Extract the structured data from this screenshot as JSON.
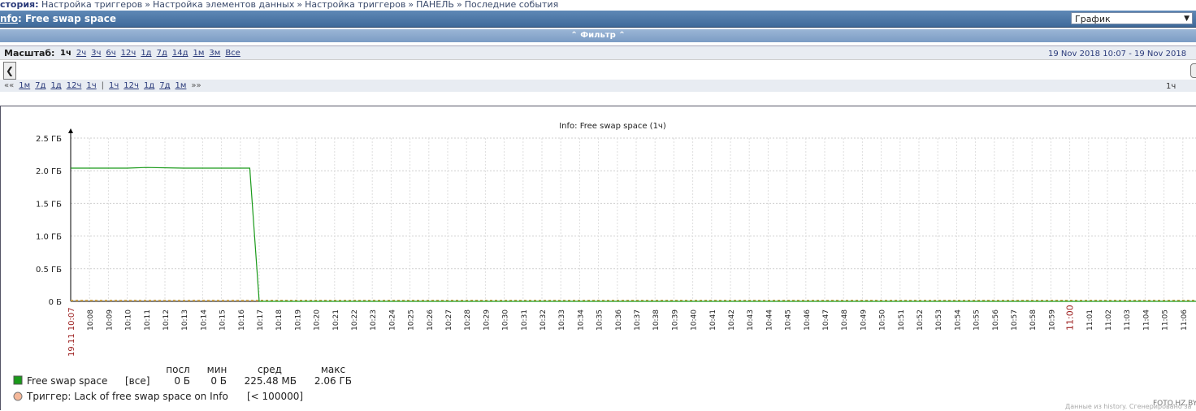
{
  "breadcrumb": {
    "items": [
      "стория:",
      "Настройка триггеров",
      "Настройка элементов данных",
      "Настройка триггеров",
      "ПАНЕЛЬ",
      "Последние события"
    ],
    "separator": "»"
  },
  "header": {
    "host": "nfo",
    "title_rest": ": Free swap space",
    "view_select": "График"
  },
  "filter": {
    "label": "Фильтр"
  },
  "scale": {
    "label": "Масштаб:",
    "options": [
      "1ч",
      "2ч",
      "3ч",
      "6ч",
      "12ч",
      "1д",
      "7д",
      "14д",
      "1м",
      "3м",
      "Все"
    ],
    "active": "1ч",
    "date_from": "19 Nov 2018 10:07",
    "date_sep": "-",
    "date_to": "19 Nov 2018"
  },
  "nav": {
    "back_glyph": "««",
    "back": [
      "1м",
      "7д",
      "1д",
      "12ч",
      "1ч"
    ],
    "divider": "|",
    "forward": [
      "1ч",
      "12ч",
      "1д",
      "7д",
      "1м"
    ],
    "fwd_glyph": "»»",
    "period": "1ч"
  },
  "chart_data": {
    "type": "line",
    "title": "Info: Free swap space (1ч)",
    "y_ticks": [
      "2.5 ГБ",
      "2.0 ГБ",
      "1.5 ГБ",
      "1.0 ГБ",
      "0.5 ГБ",
      "0 Б"
    ],
    "ylim_gb": [
      0,
      2.5
    ],
    "x_ticks": [
      "10:08",
      "10:09",
      "10:10",
      "10:11",
      "10:12",
      "10:13",
      "10:14",
      "10:15",
      "10:16",
      "10:17",
      "10:18",
      "10:19",
      "10:20",
      "10:21",
      "10:22",
      "10:23",
      "10:24",
      "10:25",
      "10:26",
      "10:27",
      "10:28",
      "10:29",
      "10:30",
      "10:31",
      "10:32",
      "10:33",
      "10:34",
      "10:35",
      "10:36",
      "10:37",
      "10:38",
      "10:39",
      "10:40",
      "10:41",
      "10:42",
      "10:43",
      "10:44",
      "10:45",
      "10:46",
      "10:47",
      "10:48",
      "10:49",
      "10:50",
      "10:51",
      "10:52",
      "10:53",
      "10:54",
      "10:55",
      "10:56",
      "10:57",
      "10:58",
      "10:59",
      "11:00",
      "11:01",
      "11:02",
      "11:03",
      "11:04",
      "11:05",
      "11:06"
    ],
    "x_start_label": "19.11 10:07",
    "highlight_tick": "11:00",
    "series": [
      {
        "name": "Free swap space",
        "color": "#1a9a1a",
        "points": [
          {
            "t": "10:07",
            "gb": 2.04
          },
          {
            "t": "10:10",
            "gb": 2.04
          },
          {
            "t": "10:11",
            "gb": 2.05
          },
          {
            "t": "10:13",
            "gb": 2.04
          },
          {
            "t": "10:16",
            "gb": 2.04
          },
          {
            "t": "10:16.5",
            "gb": 2.04
          },
          {
            "t": "10:17",
            "gb": 0
          },
          {
            "t": "11:07",
            "gb": 0
          }
        ]
      }
    ],
    "trigger": {
      "name": "Триггер: Lack of free swap space on Info",
      "condition": "[< 100000]",
      "color": "#f5b89a"
    },
    "legend": {
      "headers": [
        "посл",
        "мин",
        "сред",
        "макс"
      ],
      "row": {
        "name": "Free swap space",
        "scope": "[все]",
        "last": "0 Б",
        "min": "0 Б",
        "avg": "225.48 МБ",
        "max": "2.06 ГБ"
      }
    },
    "footer": "Данные из history. Сгенерировано за",
    "watermark": "FOTO.HZ.BY"
  }
}
